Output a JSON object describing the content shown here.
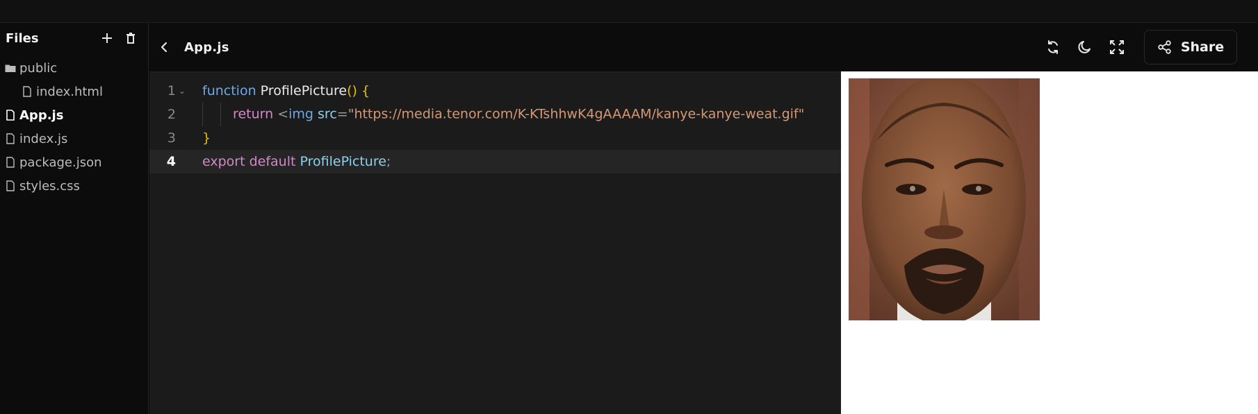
{
  "sidebar": {
    "title": "Files",
    "items": [
      {
        "label": "public",
        "type": "folder",
        "indent": false,
        "active": false
      },
      {
        "label": "index.html",
        "type": "file",
        "indent": true,
        "active": false
      },
      {
        "label": "App.js",
        "type": "file",
        "indent": false,
        "active": true
      },
      {
        "label": "index.js",
        "type": "file",
        "indent": false,
        "active": false
      },
      {
        "label": "package.json",
        "type": "file",
        "indent": false,
        "active": false
      },
      {
        "label": "styles.css",
        "type": "file",
        "indent": false,
        "active": false
      }
    ]
  },
  "editor": {
    "tab_name": "App.js",
    "current_line": 4,
    "lines": {
      "l1": {
        "num": "1",
        "kw": "function",
        "name": "ProfilePicture",
        "tail": "() {"
      },
      "l2": {
        "num": "2",
        "kw": "return",
        "lt": "<",
        "tag": "img",
        "attr": "src",
        "eq": "=",
        "str": "\"https://media.tenor.com/K-KTshhwK4gAAAAM/kanye-kanye-weat.gif\""
      },
      "l3": {
        "num": "3",
        "brace": "}"
      },
      "l4": {
        "num": "4",
        "kw": "export default",
        "name": "ProfilePicture",
        "semi": ";"
      }
    }
  },
  "preview": {
    "share_label": "Share",
    "icons": [
      "refresh-icon",
      "moon-icon",
      "fullscreen-icon",
      "share-icon"
    ]
  },
  "colors": {
    "background": "#0c0c0c",
    "editor_bg": "#1b1b1b",
    "keyword_blue": "#6ea8e6",
    "keyword_pink": "#d389c8",
    "string": "#d59875",
    "brace": "#e3c000"
  }
}
